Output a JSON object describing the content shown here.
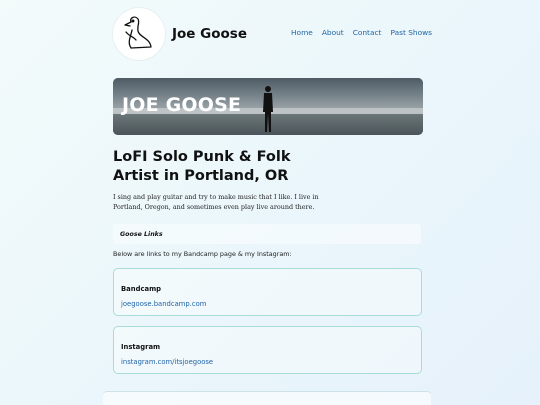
{
  "header": {
    "site_title": "Joe Goose",
    "logo_icon": "goose-icon",
    "nav": [
      "Home",
      "About",
      "Contact",
      "Past Shows"
    ]
  },
  "banner": {
    "text": "JOE GOOSE"
  },
  "main": {
    "headline_line1": "LoFI Solo Punk & Folk",
    "headline_line2": "Artist in Portland, OR",
    "intro": "I sing and play guitar and try to make music that I like. I live in Portland, Oregon, and sometimes even play live around there.",
    "section_label": "Goose Links",
    "links_intro": "Below are links to my Bandcamp page & my Instagram:"
  },
  "cards": [
    {
      "title": "Bandcamp",
      "link": "joegoose.bandcamp.com"
    },
    {
      "title": "Instagram",
      "link": "instagram.com/itsjoegoose"
    }
  ],
  "colors": {
    "link": "#1f63a8",
    "card_border": "#a9dcd6",
    "background": "#eaf6fb"
  }
}
